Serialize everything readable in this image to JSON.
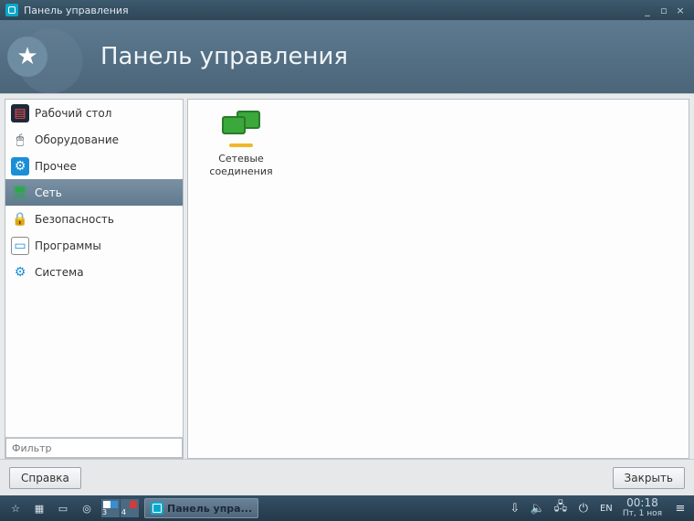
{
  "window": {
    "title": "Панель управления",
    "banner_title": "Панель управления"
  },
  "sidebar": {
    "items": [
      {
        "label": "Рабочий стол",
        "icon": "desktop-icon"
      },
      {
        "label": "Оборудование",
        "icon": "hardware-icon"
      },
      {
        "label": "Прочее",
        "icon": "other-icon"
      },
      {
        "label": "Сеть",
        "icon": "network-icon"
      },
      {
        "label": "Безопасность",
        "icon": "security-icon"
      },
      {
        "label": "Программы",
        "icon": "programs-icon"
      },
      {
        "label": "Система",
        "icon": "system-icon"
      }
    ],
    "selected_index": 3,
    "filter_placeholder": "Фильтр"
  },
  "content": {
    "modules": [
      {
        "label": "Сетевые соединения",
        "icon": "network-connections-icon"
      }
    ]
  },
  "buttons": {
    "help": "Справка",
    "close": "Закрыть"
  },
  "taskbar": {
    "task_label": "Панель упра...",
    "lang": "EN",
    "time": "00:18",
    "date": "Пт, 1 ноя",
    "workspaces": [
      "3",
      "4"
    ]
  }
}
